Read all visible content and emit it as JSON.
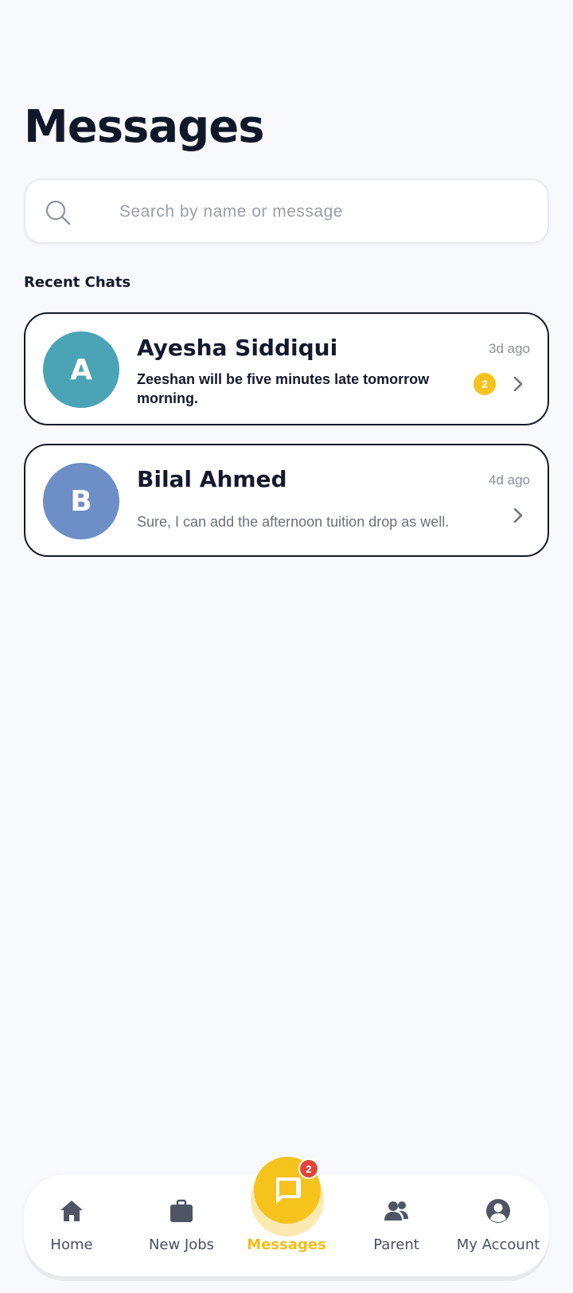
{
  "header": {
    "title": "Messages"
  },
  "search": {
    "placeholder": "Search by name or message",
    "value": ""
  },
  "section": {
    "label": "Recent Chats"
  },
  "chats": [
    {
      "initial": "A",
      "name": "Ayesha Siddiqui",
      "time": "3d ago",
      "preview": "Zeeshan will be five minutes late tomorrow morning.",
      "unread_count": "2",
      "avatar_color": "#4ba3b6"
    },
    {
      "initial": "B",
      "name": "Bilal Ahmed",
      "time": "4d ago",
      "preview": "Sure, I can add the afternoon tuition drop as well.",
      "avatar_color": "#6d8ec6"
    }
  ],
  "nav": {
    "items": [
      {
        "label": "Home",
        "icon": "home-icon"
      },
      {
        "label": "New Jobs",
        "icon": "briefcase-icon"
      },
      {
        "label": "Messages",
        "icon": "chat-icon",
        "active": true,
        "badge": "2"
      },
      {
        "label": "Parent",
        "icon": "users-icon"
      },
      {
        "label": "My Account",
        "icon": "account-icon"
      }
    ]
  },
  "colors": {
    "accent": "#f5c31c",
    "badge_red": "#e0453a",
    "background": "#f8f9fc",
    "text_dark": "#141a2c"
  }
}
